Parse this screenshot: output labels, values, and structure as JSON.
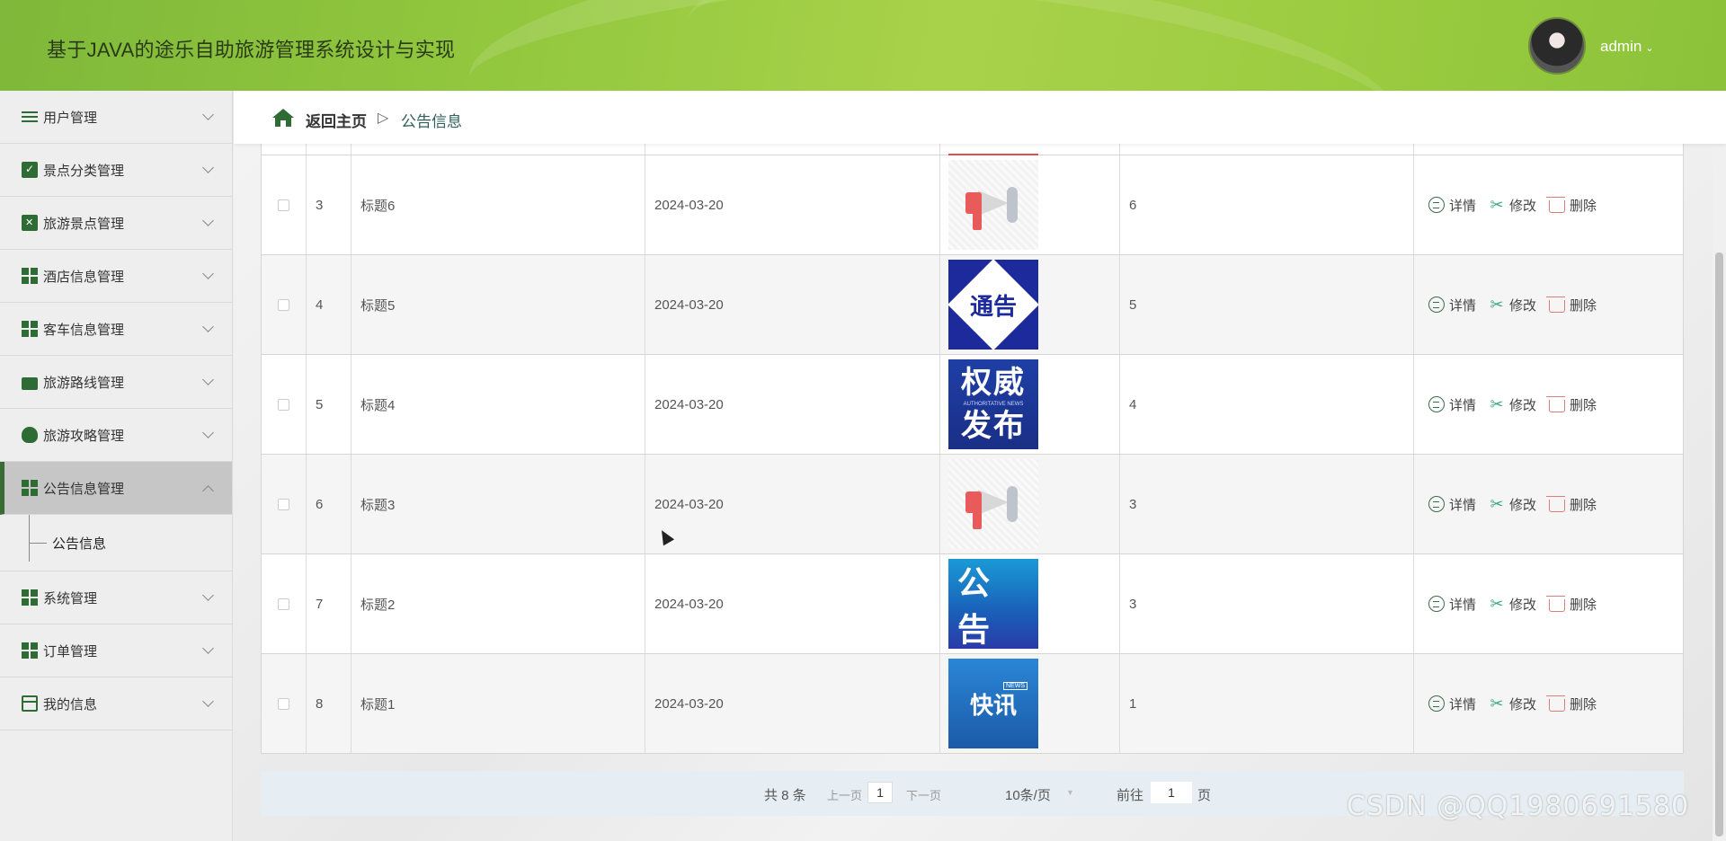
{
  "header": {
    "title": "基于JAVA的途乐自助旅游管理系统设计与实现",
    "username": "admin",
    "caret": "⌄"
  },
  "sidebar": {
    "items": [
      {
        "label": "用户管理",
        "icon": "list-icon"
      },
      {
        "label": "景点分类管理",
        "icon": "clipboard-check-icon"
      },
      {
        "label": "旅游景点管理",
        "icon": "clipboard-x-icon"
      },
      {
        "label": "酒店信息管理",
        "icon": "grid-icon"
      },
      {
        "label": "客车信息管理",
        "icon": "grid-icon"
      },
      {
        "label": "旅游路线管理",
        "icon": "briefcase-icon"
      },
      {
        "label": "旅游攻略管理",
        "icon": "bulb-icon"
      },
      {
        "label": "公告信息管理",
        "icon": "grid-icon",
        "expanded": true
      },
      {
        "label": "系统管理",
        "icon": "grid-icon"
      },
      {
        "label": "订单管理",
        "icon": "grid-icon"
      },
      {
        "label": "我的信息",
        "icon": "card-icon"
      }
    ],
    "sub_item": "公告信息"
  },
  "breadcrumb": {
    "home": "返回主页",
    "separator": "▷",
    "current": "公告信息"
  },
  "table": {
    "rows": [
      {
        "index": "3",
        "title": "标题6",
        "date": "2024-03-20",
        "image": "megaphone",
        "count": "6"
      },
      {
        "index": "4",
        "title": "标题5",
        "date": "2024-03-20",
        "image": "tonggao",
        "count": "5"
      },
      {
        "index": "5",
        "title": "标题4",
        "date": "2024-03-20",
        "image": "quanwei",
        "count": "4"
      },
      {
        "index": "6",
        "title": "标题3",
        "date": "2024-03-20",
        "image": "megaphone",
        "count": "3"
      },
      {
        "index": "7",
        "title": "标题2",
        "date": "2024-03-20",
        "image": "gonggao",
        "count": "3"
      },
      {
        "index": "8",
        "title": "标题1",
        "date": "2024-03-20",
        "image": "kuaixun",
        "count": "1"
      }
    ],
    "actions": {
      "detail": "详情",
      "edit": "修改",
      "delete": "删除"
    },
    "thumb_text": {
      "tonggao": "通告",
      "quanwei_line1": "权威",
      "quanwei_small": "AUTHORITATIVE NEWS",
      "quanwei_line2": "发布",
      "gonggao": "公告",
      "kuaixun": "快讯",
      "kuaixun_badge": "NEWS"
    }
  },
  "pagination": {
    "total": "共 8 条",
    "prev": "上一页",
    "current_page": "1",
    "next": "下一页",
    "page_size": "10条/页",
    "goto_label": "前往",
    "goto_value": "1",
    "goto_suffix": "页"
  },
  "watermark": "CSDN @QQ1980691580",
  "colors": {
    "header_green": "#9acb3f",
    "nav_accent": "#2f6b35",
    "delete_red": "#e07b7b",
    "edit_teal": "#3aa88a"
  }
}
